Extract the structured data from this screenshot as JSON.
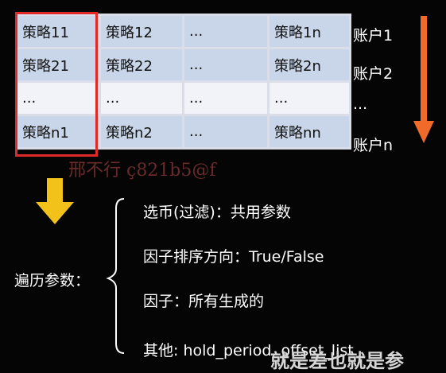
{
  "grid": {
    "rows": [
      [
        "策略11",
        "策略12",
        "...",
        "策略1n"
      ],
      [
        "策略21",
        "策略22",
        "...",
        "策略2n"
      ],
      [
        "...",
        "...",
        "...",
        "..."
      ],
      [
        "策略n1",
        "策略n2",
        "...",
        "策略nn"
      ]
    ]
  },
  "accounts": [
    "账户1",
    "账户2",
    "...",
    "账户n"
  ],
  "watermark": "邢不行 ç821b5@f",
  "params": {
    "label": "遍历参数：",
    "items": [
      "选币(过滤)：共用参数",
      "因子排序方向：True/False",
      "因子：所有生成的",
      "其他: hold_period, offset_list"
    ]
  },
  "footer_caption": "就是差也就是参",
  "colors": {
    "highlight": "#e02a2a",
    "down_arrow": "#f06a2a",
    "yellow_arrow": "#f2c21b",
    "row_dark": "#c9d6ea",
    "row_light": "#f1f3f9"
  }
}
